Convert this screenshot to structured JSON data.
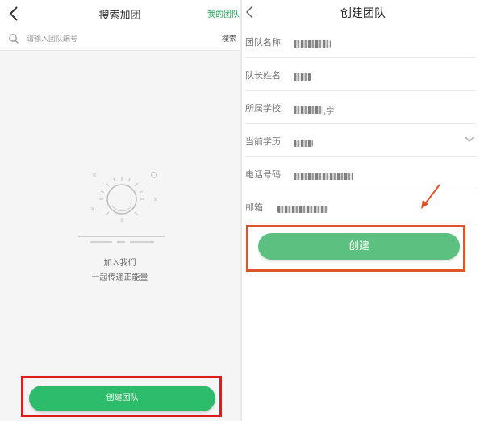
{
  "left": {
    "nav": {
      "title": "搜索加团",
      "my_team": "我的团队"
    },
    "search": {
      "placeholder": "请输入团队编号",
      "button": "搜索"
    },
    "empty_state": {
      "line1": "加入我们",
      "line2": "一起传递正能量"
    },
    "create_team_label": "创建团队",
    "colors": {
      "accent": "#2dbc6b",
      "highlight": "#e01b1b"
    }
  },
  "right": {
    "nav": {
      "title": "创建团队"
    },
    "form": [
      {
        "label": "团队名称",
        "icon": "none"
      },
      {
        "label": "队长姓名",
        "icon": "none"
      },
      {
        "label": "所属学校",
        "value_suffix": ",学",
        "icon": "none"
      },
      {
        "label": "当前学历",
        "icon": "chevron-down-icon"
      },
      {
        "label": "电话号码",
        "icon": "none"
      },
      {
        "label": "邮箱",
        "icon": "none"
      }
    ],
    "create_label": "创建",
    "colors": {
      "accent": "#5cc080",
      "highlight": "#e0542a"
    }
  }
}
